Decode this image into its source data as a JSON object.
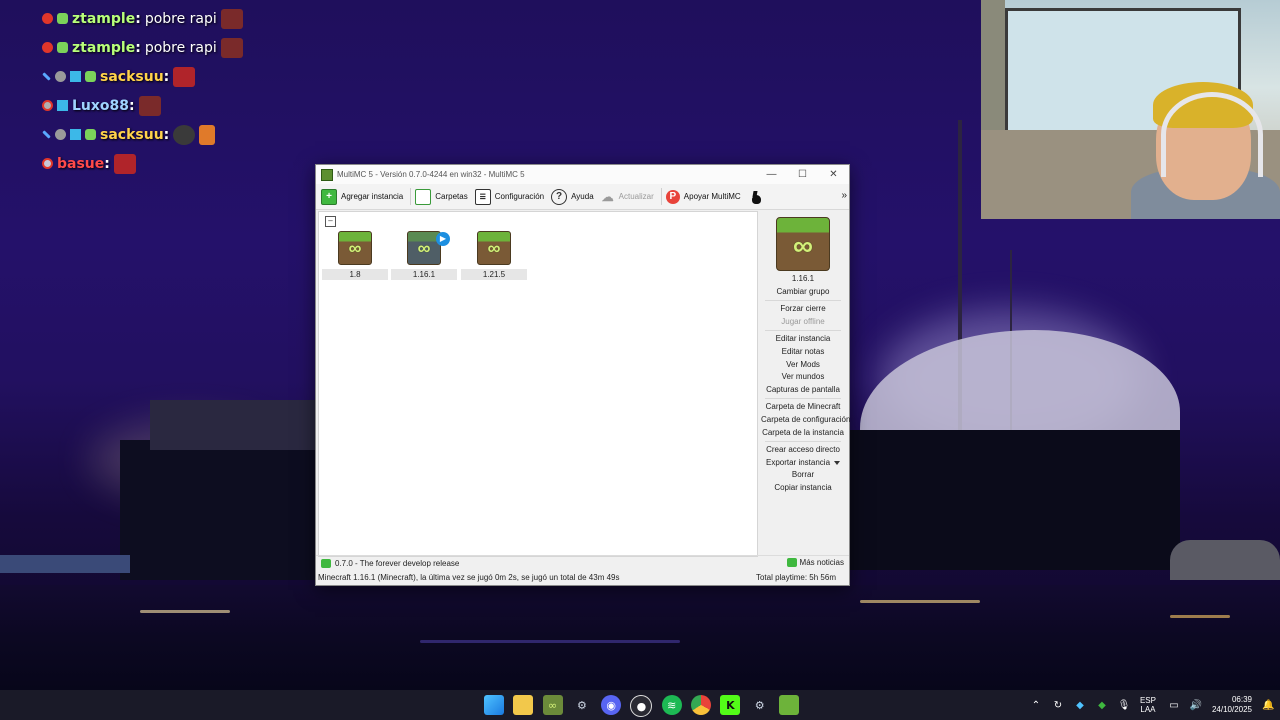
{
  "chat": {
    "messages": [
      {
        "user": "ztample",
        "user_color": "#b8ff7a",
        "message": "pobre rapi",
        "badges": [
          "red-ball-badge",
          "green-creature-badge"
        ],
        "emotes": [
          "angry-face-emote"
        ]
      },
      {
        "user": "ztample",
        "user_color": "#b8ff7a",
        "message": "pobre rapi",
        "badges": [
          "red-ball-badge",
          "green-creature-badge"
        ],
        "emotes": [
          "angry-face-emote"
        ]
      },
      {
        "user": "sacksuu",
        "user_color": "#ffd24a",
        "message": "",
        "badges": [
          "sword-badge",
          "gray-orb-badge",
          "blue-cube-badge",
          "green-creature-badge"
        ],
        "emotes": [
          "red-mask-emote"
        ]
      },
      {
        "user": "Luxo88",
        "user_color": "#9fd3ff",
        "message": "",
        "badges": [
          "gray-eye-badge",
          "blue-cube-badge"
        ],
        "emotes": [
          "angry-face-emote"
        ]
      },
      {
        "user": "sacksuu",
        "user_color": "#ffd24a",
        "message": "",
        "badges": [
          "sword-badge",
          "gray-orb-badge",
          "blue-cube-badge",
          "green-creature-badge"
        ],
        "emotes": [
          "shadow-face-emote",
          "fire-emote"
        ]
      },
      {
        "user": "basue",
        "user_color": "#ff4a4a",
        "message": "",
        "badges": [
          "red-orb-badge"
        ],
        "emotes": [
          "red-mask-emote"
        ]
      }
    ]
  },
  "multimc": {
    "title": "MultiMC 5 - Versión 0.7.0-4244 en win32 - MultiMC 5",
    "window_controls": {
      "minimize": "—",
      "maximize": "☐",
      "close": "✕"
    },
    "toolbar": {
      "add_instance": "Agregar instancia",
      "folders": "Carpetas",
      "settings": "Configuración",
      "help": "Ayuda",
      "update": "Actualizar",
      "support": "Apoyar MultiMC",
      "more": "»"
    },
    "group_toggle": "–",
    "instances": [
      {
        "name": "1.8",
        "selected": false,
        "running": false
      },
      {
        "name": "1.16.1",
        "selected": true,
        "running": true
      },
      {
        "name": "1.21.5",
        "selected": false,
        "running": false
      }
    ],
    "side_panel": {
      "instance_name": "1.16.1",
      "change_group": "Cambiar grupo",
      "force_close": "Forzar cierre",
      "play_offline": "Jugar offline",
      "edit_instance": "Editar instancia",
      "edit_notes": "Editar notas",
      "view_mods": "Ver Mods",
      "view_worlds": "Ver mundos",
      "screenshots": "Capturas de pantalla",
      "minecraft_folder": "Carpeta de Minecraft",
      "config_folder": "Carpeta de configuración",
      "instance_folder": "Carpeta de la instancia",
      "create_shortcut": "Crear acceso directo",
      "export_instance": "Exportar instancia",
      "delete": "Borrar",
      "copy_instance": "Copiar instancia"
    },
    "news": {
      "text": "0.7.0 - The forever develop release",
      "more": "Más noticias"
    },
    "status": {
      "left": "Minecraft 1.16.1 (Minecraft), la última vez se jugó 0m 2s, se jugó un total de 43m 49s",
      "right": "Total playtime: 5h 56m"
    }
  },
  "taskbar": {
    "apps": [
      "windows-start-icon",
      "file-explorer-icon",
      "multimc-icon",
      "steam-icon",
      "discord-icon",
      "obs-icon",
      "spotify-icon",
      "chrome-icon",
      "kick-icon",
      "steam-icon",
      "minecraft-icon"
    ],
    "tray": {
      "language_top": "ESP",
      "language_bottom": "LAA",
      "time": "06:39",
      "date": "24/10/2025"
    }
  }
}
